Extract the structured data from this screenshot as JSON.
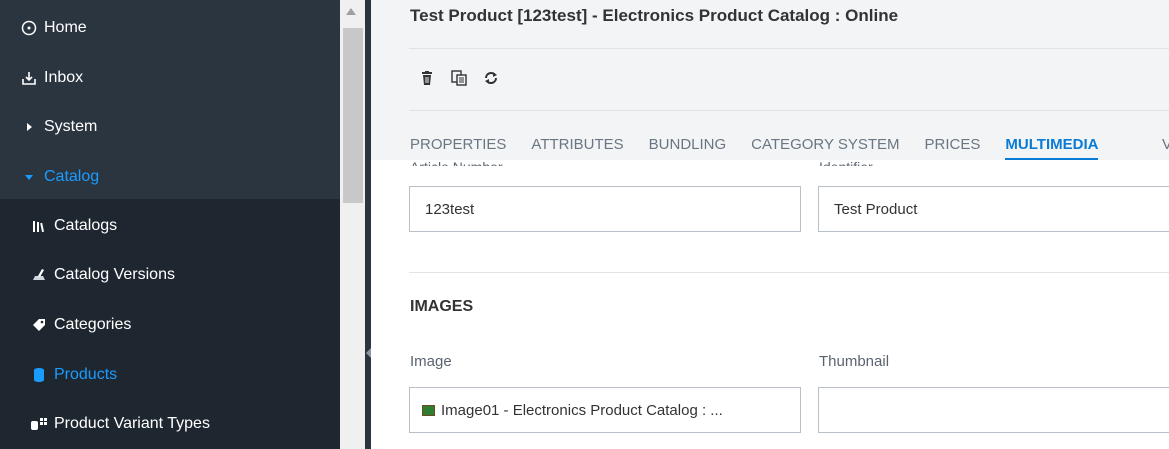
{
  "sidebar": {
    "items": [
      {
        "label": "Home",
        "icon": "compass-icon"
      },
      {
        "label": "Inbox",
        "icon": "inbox-icon"
      },
      {
        "label": "System",
        "icon": "caret-right-icon"
      },
      {
        "label": "Catalog",
        "icon": "caret-down-icon"
      },
      {
        "label": "Catalogs",
        "icon": "books-icon"
      },
      {
        "label": "Catalog Versions",
        "icon": "catalog-versions-icon"
      },
      {
        "label": "Categories",
        "icon": "tag-icon"
      },
      {
        "label": "Products",
        "icon": "cylinder-icon"
      },
      {
        "label": "Product Variant Types",
        "icon": "variant-types-icon"
      }
    ],
    "accent_color": "#1a9cff"
  },
  "editor": {
    "title": "Test Product [123test] - Electronics Product Catalog : Online",
    "toolbar": [
      {
        "icon": "trash-icon"
      },
      {
        "icon": "clone-icon"
      },
      {
        "icon": "refresh-icon"
      }
    ],
    "tabs": [
      {
        "label": "PROPERTIES"
      },
      {
        "label": "ATTRIBUTES"
      },
      {
        "label": "BUNDLING"
      },
      {
        "label": "CATEGORY SYSTEM"
      },
      {
        "label": "PRICES"
      },
      {
        "label": "MULTIMEDIA"
      }
    ],
    "tab_peek": "V",
    "fields": {
      "article_number": {
        "label": "Article Number",
        "value": "123test"
      },
      "identifier": {
        "label": "Identifier",
        "value": "Test Product"
      }
    },
    "images_section": {
      "title": "IMAGES",
      "image_label": "Image",
      "image_value": "Image01 - Electronics Product Catalog : ...",
      "thumbnail_label": "Thumbnail",
      "thumbnail_value": ""
    }
  }
}
